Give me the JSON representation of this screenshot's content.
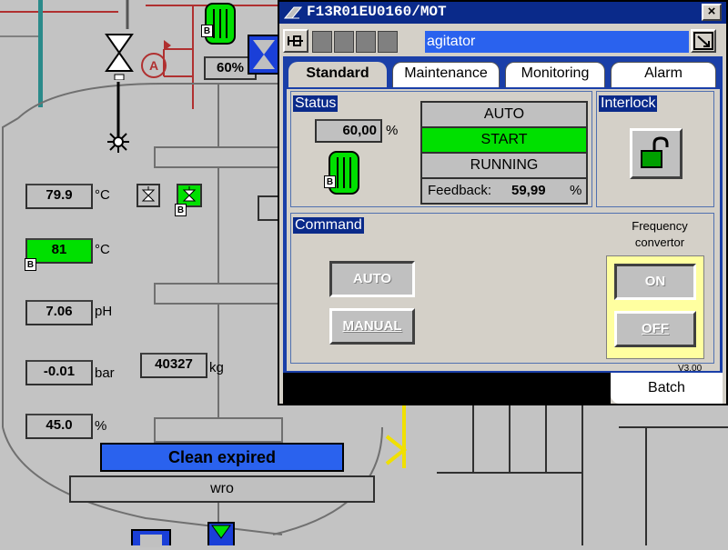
{
  "scada": {
    "valve_pct": "60%",
    "readings": [
      {
        "value": "79.9",
        "unit": "°C"
      },
      {
        "value": "81",
        "unit": "°C"
      },
      {
        "value": "7.06",
        "unit": "pH"
      },
      {
        "value": "-0.01",
        "unit": "bar"
      },
      {
        "value": "45.0",
        "unit": "%"
      }
    ],
    "weight": {
      "value": "40327",
      "unit": "kg"
    },
    "b_label": "B",
    "valve_letter": "A",
    "status_banner": "Clean expired",
    "wro_label": "wro"
  },
  "dialog": {
    "title": "F13R01EU0160/MOT",
    "close_label": "×",
    "description": "agitator",
    "tabs": [
      "Standard",
      "Maintenance",
      "Monitoring",
      "Alarm"
    ],
    "active_tab": "Standard",
    "status_title": "Status",
    "speed_value": "60,00",
    "speed_unit": "%",
    "mode": "AUTO",
    "command_state": "START",
    "run_state": "RUNNING",
    "feedback_label": "Feedback:",
    "feedback_value": "59,99",
    "feedback_unit": "%",
    "interlock_title": "Interlock",
    "command_title": "Command",
    "btn_auto": "AUTO",
    "btn_manual": "MANUAL",
    "freq_label_1": "Frequency",
    "freq_label_2": "convertor",
    "btn_on": "ON",
    "btn_off": "OFF",
    "version": "V3.00",
    "batch_tab": "Batch",
    "colors": {
      "running": "#00e000",
      "title_bar": "#0a2a8a",
      "banner": "#2a62ee"
    }
  }
}
